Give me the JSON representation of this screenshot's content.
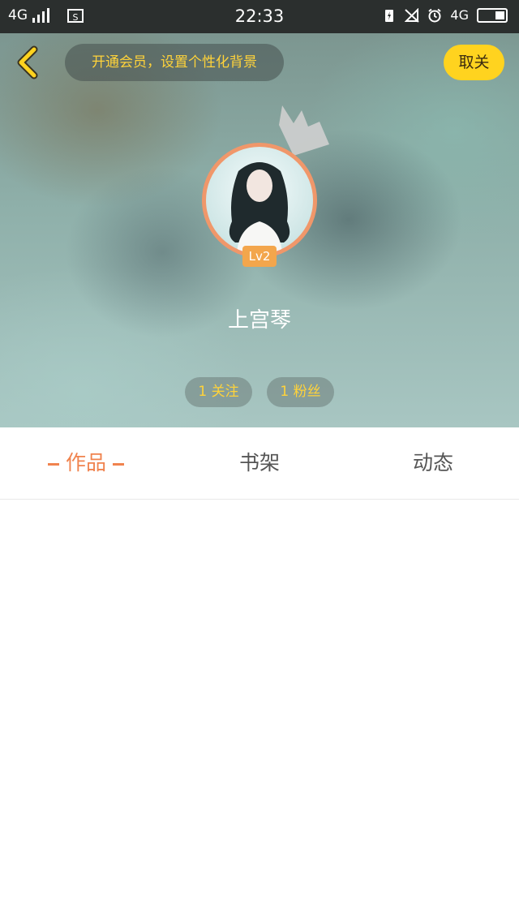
{
  "status_bar": {
    "network": "4G",
    "network_right": "4G",
    "time": "22:33",
    "sim_label": "S",
    "icons": [
      "signal-icon",
      "screenshot-icon",
      "battery-saver-icon",
      "no-signal-icon",
      "alarm-icon",
      "battery-icon"
    ]
  },
  "header": {
    "back_icon": "chevron-left-icon",
    "vip_banner": "开通会员，设置个性化背景",
    "close_label": "取关",
    "crown_icon": "crown-icon",
    "level_badge": "Lv2",
    "username": "上宫琴",
    "following": "1 关注",
    "fans": "1 粉丝",
    "colors": {
      "accent_yellow": "#ffd31f",
      "tab_active": "#f0834e",
      "avatar_ring": "#f0976a",
      "level_badge": "#f3a64c"
    }
  },
  "tabs": [
    {
      "label": "作品",
      "active": true
    },
    {
      "label": "书架",
      "active": false
    },
    {
      "label": "动态",
      "active": false
    }
  ]
}
